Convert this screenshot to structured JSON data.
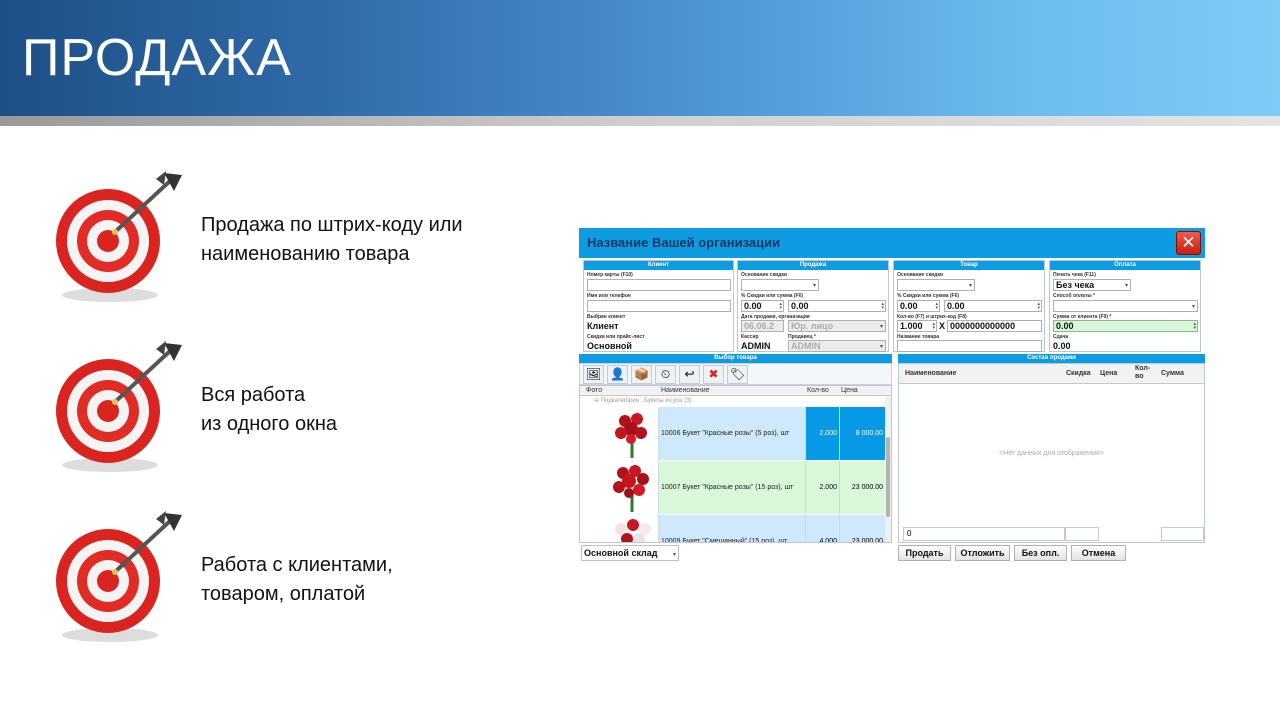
{
  "slide": {
    "title": "ПРОДАЖА",
    "bullets": [
      {
        "line1": "Продажа по штрих-коду или",
        "line2": "наименованию товара"
      },
      {
        "line1": "Вся работа",
        "line2": "из одного окна"
      },
      {
        "line1": "Работа с клиентами,",
        "line2": "товаром, оплатой"
      }
    ]
  },
  "window": {
    "title": "Название Вашей организации",
    "close_glyph": "✕",
    "client": {
      "header": "Клиент",
      "card_label": "Номер карты (F10)",
      "name_label": "Имя или телефон",
      "selected_label": "Выбран клиент",
      "selected_value": "Клиент",
      "discount_label": "Скидка или прайс-лист",
      "discount_value": "Основной"
    },
    "sale": {
      "header": "Продажа",
      "basis_label": "Основание скидки",
      "pct_label": "% Скидки или сумма (F6)",
      "pct_value": "0.00",
      "sum_value": "0.00",
      "date_label": "Дата продажи, организация",
      "date_value": "06.06.2",
      "org_value": "Юр. лицо",
      "cashier_label": "Кассир",
      "cashier_value": "ADMIN",
      "seller_label": "Продавец *",
      "seller_value": "ADMIN"
    },
    "goods": {
      "header": "Товар",
      "basis_label": "Основание скидки",
      "pct_label": "% Скидки или сумма (F6)",
      "pct_value": "0.00",
      "sum_value": "0.00",
      "qty_label": "Кол-во (F7) и штрих-код (F8)",
      "qty_value": "1.000",
      "x_sign": "X",
      "barcode_value": "0000000000000",
      "name_label": "Название товара"
    },
    "payment": {
      "header": "Оплата",
      "print_label": "Печать чека (F11)",
      "print_value": "Без чека",
      "method_label": "Способ оплаты *",
      "client_sum_label": "Сумма от клиента (F9) *",
      "client_sum_value": "0.00",
      "change_label": "Сдача",
      "change_value": "0.00"
    },
    "product_select": {
      "header": "Выбор товара",
      "columns": [
        "Фото",
        "Наименование",
        "Кол-во",
        "Цена"
      ],
      "group_label": "Подкатегория : Букеты из роз (3)",
      "rows": [
        {
          "name": "10006 Букет \"Красные розы\" (5 роз), шт",
          "qty": "2.000",
          "price": "8 000.00"
        },
        {
          "name": "10007 Букет \"Красные розы\" (15 роз), шт",
          "qty": "2.000",
          "price": "23 000.00"
        },
        {
          "name": "10009 Букет \"Смешанный\" (15 роз), шт",
          "qty": "4.000",
          "price": "23 000.00"
        }
      ],
      "warehouse": "Основной склад"
    },
    "sale_items": {
      "header": "Состав продажи",
      "columns": [
        "Наименование",
        "Скидка",
        "Цена",
        "Кол-во",
        "Сумма"
      ],
      "empty_text": "<Нет данных для отображения>",
      "total_qty": "0"
    },
    "buttons": {
      "sell": "Продать",
      "postpone": "Отложить",
      "no_payment": "Без опл.",
      "cancel": "Отмена"
    }
  }
}
